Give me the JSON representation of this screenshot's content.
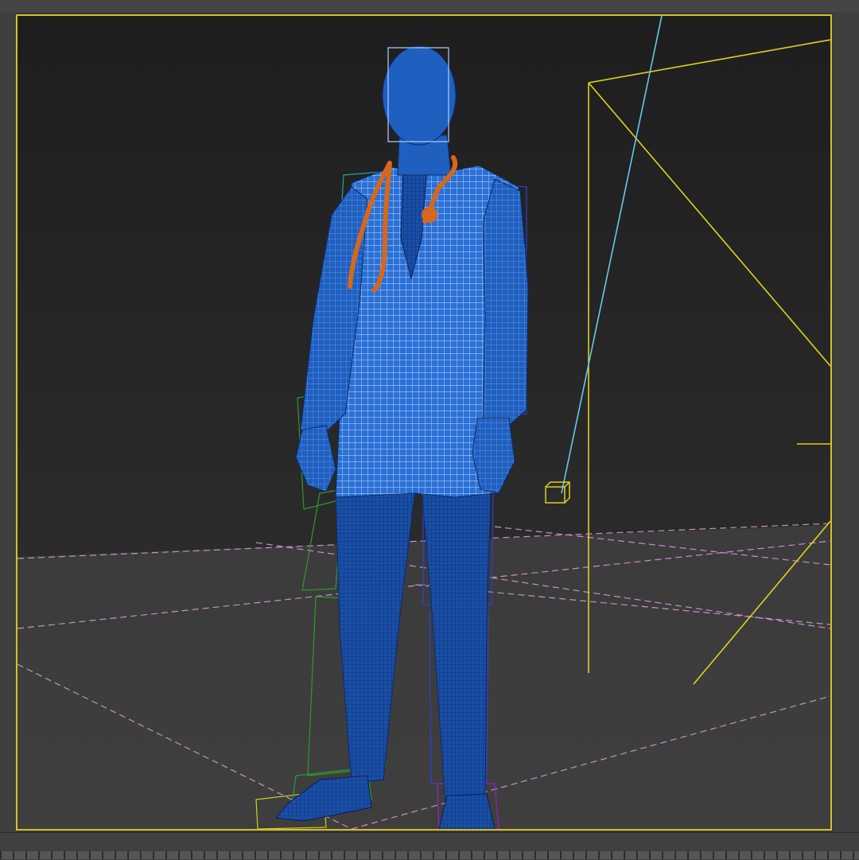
{
  "viewport": {
    "active_border_color": "#d8c020",
    "background_top": "#1e1e1e",
    "background_bottom": "#303030"
  },
  "colors": {
    "mesh_blue": "#1f5fbf",
    "mesh_wire": "#8fb8ff",
    "stethoscope": "#d6671c",
    "grid_line": "#e0a0e0",
    "light_yellow": "#e0d020",
    "light_cyan": "#66c8f0",
    "bone_green": "#2e9a2e",
    "bone_blue": "#3040d0",
    "bone_purple": "#9a20c0"
  },
  "icons": {
    "light_target": "cube-icon",
    "bone_helper": "bone-icon"
  }
}
